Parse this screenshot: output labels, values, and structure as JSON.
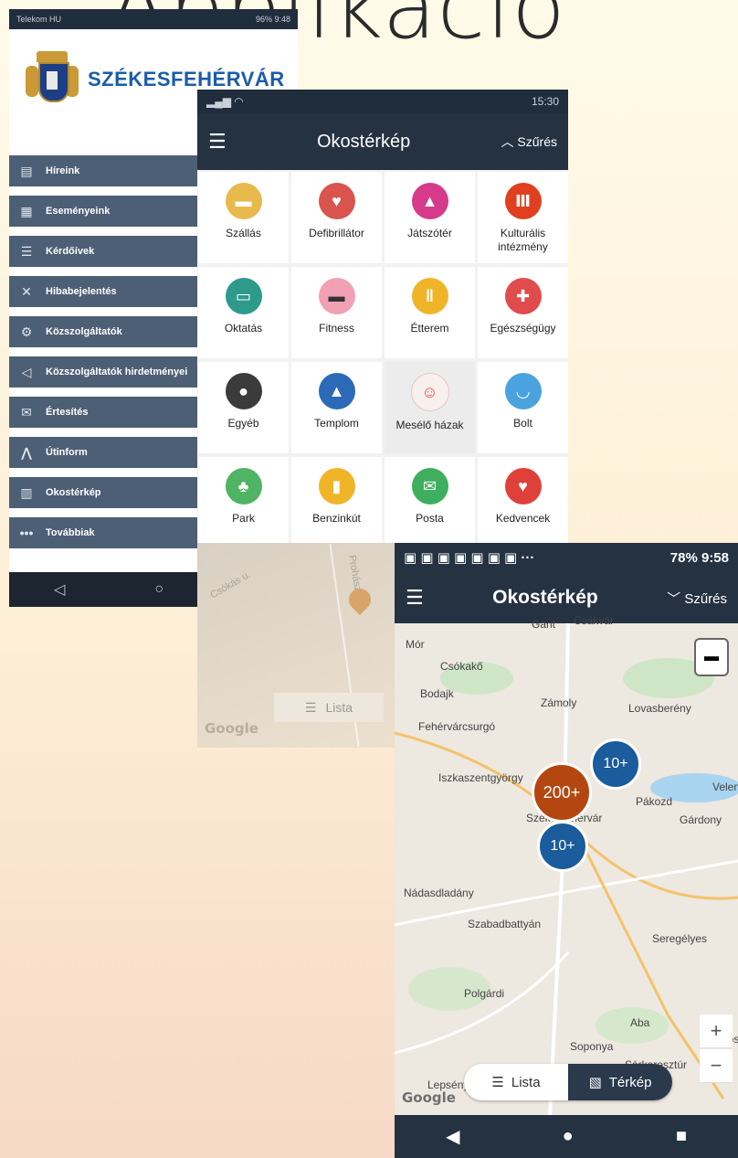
{
  "slide": {
    "title": "Applikáció"
  },
  "phone1": {
    "status_left": "Telekom HU ",
    "status_right": "96% 9:48",
    "city": "SZÉKESFEHÉRVÁR",
    "menu": [
      {
        "label": "Híreink",
        "icon": "news-icon"
      },
      {
        "label": "Eseményeink",
        "icon": "calendar-icon"
      },
      {
        "label": "Kérdőívek",
        "icon": "list-icon"
      },
      {
        "label": "Hibabejelentés",
        "icon": "tools-icon"
      },
      {
        "label": "Közszolgáltatók",
        "icon": "gears-icon"
      },
      {
        "label": "Közszolgáltatók hirdetményei",
        "icon": "megaphone-icon"
      },
      {
        "label": "Értesítés",
        "icon": "mail-icon"
      },
      {
        "label": "Útinform",
        "icon": "road-icon"
      },
      {
        "label": "Okostérkép",
        "icon": "building-icon"
      },
      {
        "label": "Továbbiak",
        "icon": "dots-icon"
      }
    ]
  },
  "phone2": {
    "status_right": "15:30",
    "title": "Okostérkép",
    "filter": "Szűrés",
    "categories": [
      {
        "label": "Szállás",
        "color": "#e8b94c",
        "glyph": "▬"
      },
      {
        "label": "Defibrillátor",
        "color": "#d9534f",
        "glyph": "♥"
      },
      {
        "label": "Játszótér",
        "color": "#d63a8a",
        "glyph": "▲"
      },
      {
        "label": "Kulturális intézmény",
        "color": "#e0401f",
        "glyph": "Ⅲ"
      },
      {
        "label": "Oktatás",
        "color": "#2d9a8c",
        "glyph": "▭"
      },
      {
        "label": "Fitness",
        "color": "#f2a0b4",
        "glyph": "▬"
      },
      {
        "label": "Étterem",
        "color": "#f0b428",
        "glyph": "ǁ"
      },
      {
        "label": "Egészségügy",
        "color": "#e04b4b",
        "glyph": "✚"
      },
      {
        "label": "Egyéb",
        "color": "#3b3b3b",
        "glyph": "●"
      },
      {
        "label": "Templom",
        "color": "#2c6ab8",
        "glyph": "▲"
      },
      {
        "label": "Mesélő házak",
        "color": "#f7f0ee",
        "glyph": "☺"
      },
      {
        "label": "Bolt",
        "color": "#4aa3df",
        "glyph": "◡"
      },
      {
        "label": "Park",
        "color": "#4fb463",
        "glyph": "♣"
      },
      {
        "label": "Benzinkút",
        "color": "#f0b428",
        "glyph": "▮"
      },
      {
        "label": "Posta",
        "color": "#3fae5f",
        "glyph": "✉"
      },
      {
        "label": "Kedvencek",
        "color": "#e0403a",
        "glyph": "♥"
      }
    ],
    "map": {
      "street1": "Csókás u.",
      "street2": "Prohászk",
      "lista": "Lista",
      "google": "Google"
    }
  },
  "phone3": {
    "status_right": "78% 9:58",
    "title": "Okostérkép",
    "filter": "Szűrés",
    "places": [
      "Gant",
      "Csákvár",
      "Mór",
      "Csókakő",
      "Bodajk",
      "Zámoly",
      "Lovasberény",
      "Fehérvárcsurgó",
      "Iszkaszentgyörgy",
      "Pákozd",
      "Velen",
      "Gárdony",
      "Székesfehérvár",
      "Nádasdladány",
      "Szabadbattyán",
      "Seregélyes",
      "Polgárdi",
      "Aba",
      "Sáros",
      "Soponya",
      "Sárkeresztúr",
      "Lepsény"
    ],
    "clusters": [
      "10+",
      "200+",
      "10+"
    ],
    "lista": "Lista",
    "terkep": "Térkép",
    "google": "Google",
    "zoom_in": "+",
    "zoom_out": "−"
  }
}
